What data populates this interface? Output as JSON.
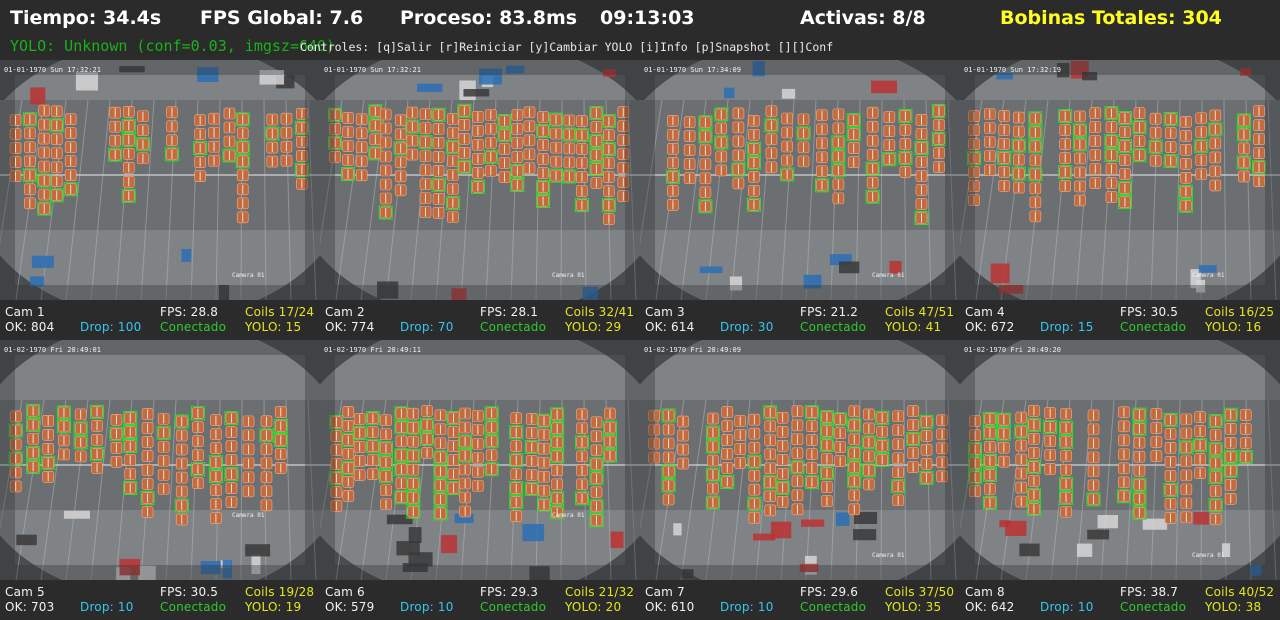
{
  "header": {
    "tiempo": "Tiempo: 34.4s",
    "fps_global": "FPS Global: 7.6",
    "proceso": "Proceso: 83.8ms",
    "clock": "09:13:03",
    "activas": "Activas: 8/8",
    "bobinas_totales": "Bobinas Totales: 304",
    "yolo_status": "YOLO: Unknown (conf=0.03, imgsz=640)",
    "controls": "Controles: [q]Salir [r]Reiniciar [y]Cambiar YOLO [i]Info [p]Snapshot [][]Conf"
  },
  "colors": {
    "accent_yellow": "#e6e61e",
    "ok_green": "#2ccc2c",
    "drop_cyan": "#35c7f2",
    "bbox_green": "#29e229",
    "coil_copper": "#c46a3c"
  },
  "cameras": [
    {
      "name": "Cam 1",
      "ok": "OK: 804",
      "drop": "Drop: 100",
      "fps": "FPS: 28.8",
      "status": "Conectado",
      "coils": "Coils 17/24",
      "yolo": "YOLO: 15",
      "stamp": "01-01-1970 Sun 17:32:21",
      "label": "Camera 01"
    },
    {
      "name": "Cam 2",
      "ok": "OK: 774",
      "drop": "Drop: 70",
      "fps": "FPS: 28.1",
      "status": "Conectado",
      "coils": "Coils 32/41",
      "yolo": "YOLO: 29",
      "stamp": "01-01-1970 Sun 17:32:21",
      "label": "Camera 01"
    },
    {
      "name": "Cam 3",
      "ok": "OK: 614",
      "drop": "Drop: 30",
      "fps": "FPS: 21.2",
      "status": "Conectado",
      "coils": "Coils 47/51",
      "yolo": "YOLO: 41",
      "stamp": "01-01-1970 Sun 17:34:09",
      "label": "Camera 01"
    },
    {
      "name": "Cam 4",
      "ok": "OK: 672",
      "drop": "Drop: 15",
      "fps": "FPS: 30.5",
      "status": "Conectado",
      "coils": "Coils 16/25",
      "yolo": "YOLO: 16",
      "stamp": "01-01-1970 Sun 17:32:19",
      "label": "Camera 01"
    },
    {
      "name": "Cam 5",
      "ok": "OK: 703",
      "drop": "Drop: 10",
      "fps": "FPS: 30.5",
      "status": "Conectado",
      "coils": "Coils 19/28",
      "yolo": "YOLO: 19",
      "stamp": "01-02-1970 Fri 20:49:01",
      "label": "Camera 01"
    },
    {
      "name": "Cam 6",
      "ok": "OK: 579",
      "drop": "Drop: 10",
      "fps": "FPS: 29.3",
      "status": "Conectado",
      "coils": "Coils 21/32",
      "yolo": "YOLO: 20",
      "stamp": "01-02-1970 Fri 20:49:11",
      "label": "Camera 01"
    },
    {
      "name": "Cam 7",
      "ok": "OK: 610",
      "drop": "Drop: 10",
      "fps": "FPS: 29.6",
      "status": "Conectado",
      "coils": "Coils 37/50",
      "yolo": "YOLO: 35",
      "stamp": "01-02-1970 Fri 20:49:09",
      "label": "Camera 01"
    },
    {
      "name": "Cam 8",
      "ok": "OK: 642",
      "drop": "Drop: 10",
      "fps": "FPS: 38.7",
      "status": "Conectado",
      "coils": "Coils 40/52",
      "yolo": "YOLO: 38",
      "stamp": "01-02-1970 Fri 20:49:20",
      "label": "Camera 01"
    }
  ]
}
